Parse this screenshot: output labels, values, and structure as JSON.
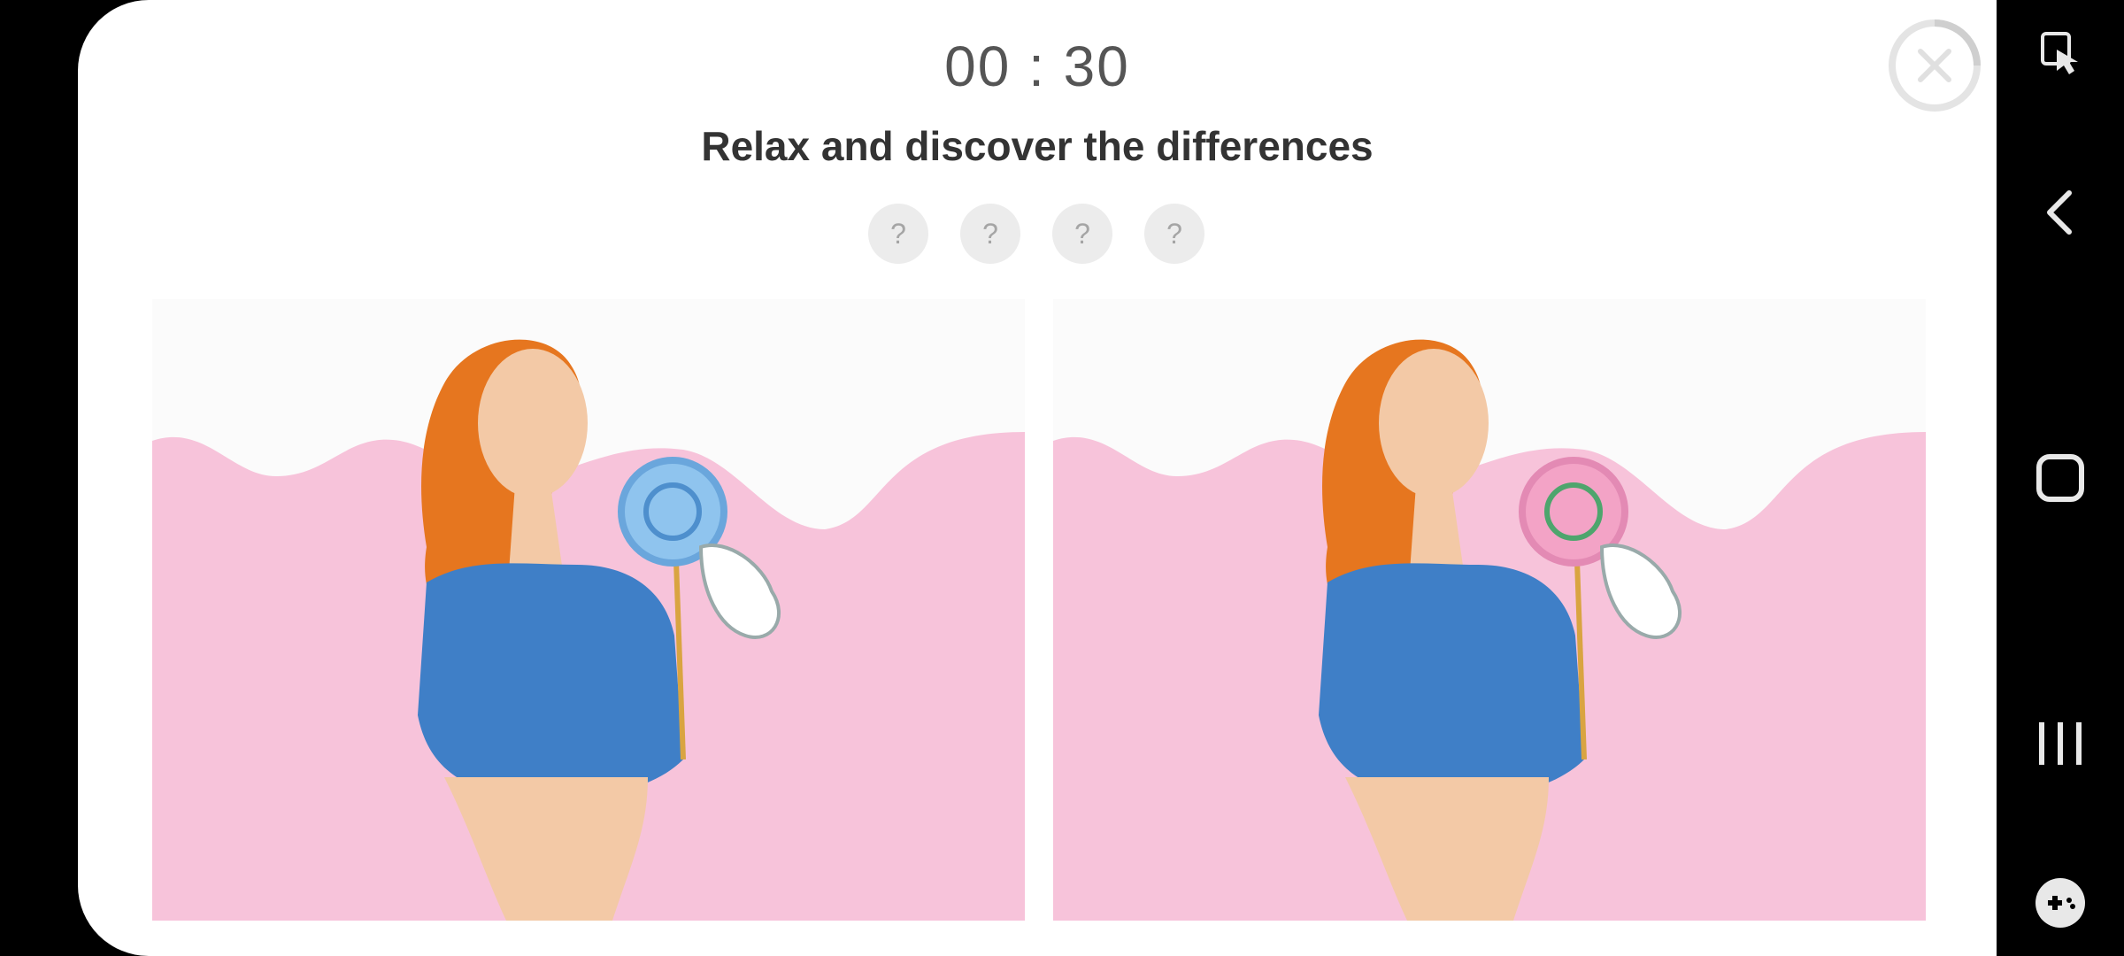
{
  "game": {
    "timer": "00 : 30",
    "instruction": "Relax and discover the differences",
    "hint_slots": [
      "?",
      "?",
      "?",
      "?"
    ]
  },
  "colors": {
    "background": "#f7c3da",
    "shirt": "#3f7fc7",
    "hair": "#e6761f",
    "skin": "#f3c9a6",
    "lollipop_left": "#8fc4ee",
    "lollipop_right": "#f3a3c6"
  },
  "icons": {
    "close": "close-icon",
    "accessibility": "touch-assist-icon",
    "back": "back-arrow-icon",
    "home": "home-icon",
    "recents": "recents-icon",
    "game_tools": "gamepad-icon"
  }
}
